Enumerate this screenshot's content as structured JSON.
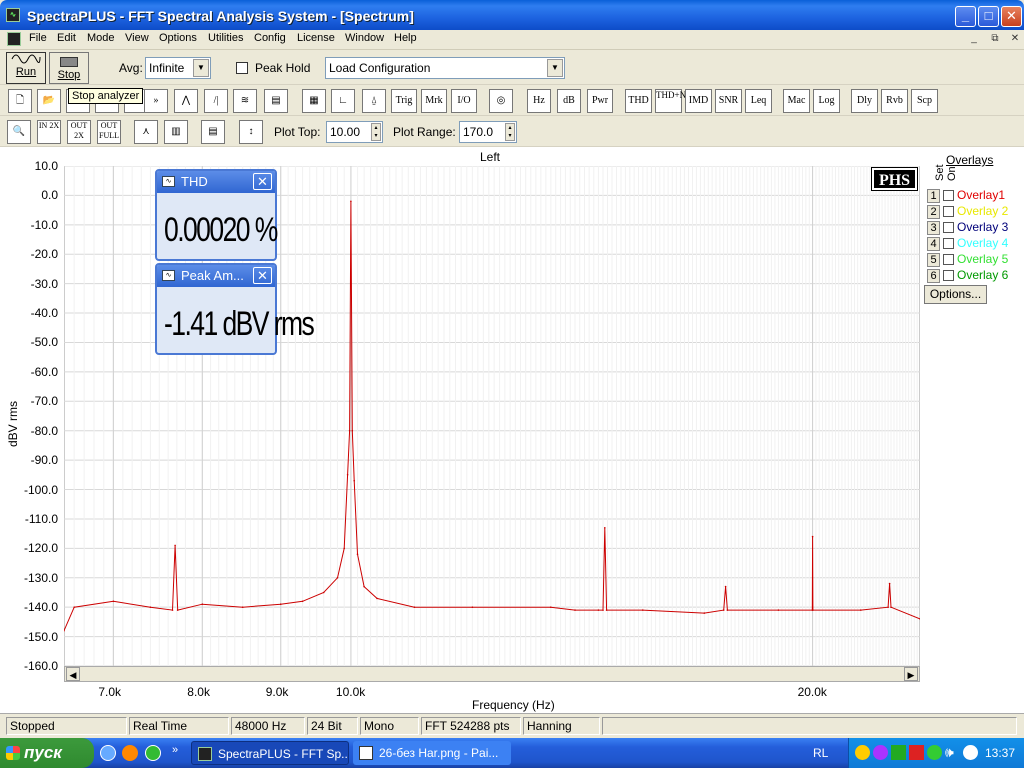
{
  "window": {
    "title": "SpectraPLUS - FFT Spectral Analysis System - [Spectrum]"
  },
  "menu": [
    "File",
    "Edit",
    "Mode",
    "View",
    "Options",
    "Utilities",
    "Config",
    "License",
    "Window",
    "Help"
  ],
  "toolbar1": {
    "run_label": "Run",
    "stop_label": "Stop",
    "avg_label": "Avg:",
    "avg_value": "Infinite",
    "peak_hold_label": "Peak Hold",
    "config_value": "Load Configuration"
  },
  "tooltip": "Stop analyzer",
  "toolbar2": {
    "buttons": [
      "Trig",
      "Mrk",
      "I/O",
      "Hz",
      "dB",
      "Pwr",
      "THD",
      "THD+N",
      "IMD",
      "SNR",
      "Leq",
      "Mac",
      "Log",
      "Dly",
      "Rvb",
      "Scp"
    ]
  },
  "toolbar3": {
    "zoom_labels": [
      "IN 2X",
      "OUT 2X",
      "OUT FULL"
    ],
    "plot_top_label": "Plot Top:",
    "plot_top_value": "10.00",
    "plot_range_label": "Plot Range:",
    "plot_range_value": "170.0"
  },
  "plot": {
    "channel": "Left",
    "logo": "PHS",
    "ylabel": "dBV rms",
    "xlabel": "Frequency (Hz)"
  },
  "chart_data": {
    "type": "line",
    "title": "Left",
    "xlabel": "Frequency (Hz)",
    "ylabel": "dBV rms",
    "x_scale": "log",
    "xlim": [
      6500,
      23500
    ],
    "ylim": [
      -160,
      10
    ],
    "y_ticks": [
      "10.0",
      "0.0",
      "-10.0",
      "-20.0",
      "-30.0",
      "-40.0",
      "-50.0",
      "-60.0",
      "-70.0",
      "-80.0",
      "-90.0",
      "-100.0",
      "-110.0",
      "-120.0",
      "-130.0",
      "-140.0",
      "-150.0",
      "-160.0"
    ],
    "x_ticks": [
      {
        "label": "7.0k",
        "value": 7000
      },
      {
        "label": "8.0k",
        "value": 8000
      },
      {
        "label": "9.0k",
        "value": 9000
      },
      {
        "label": "10.0k",
        "value": 10000
      },
      {
        "label": "20.0k",
        "value": 20000
      }
    ],
    "grid": true,
    "series": [
      {
        "color": "#cc0000",
        "points": [
          [
            6500,
            -148
          ],
          [
            6600,
            -140
          ],
          [
            7000,
            -138
          ],
          [
            7400,
            -140
          ],
          [
            7650,
            -141
          ],
          [
            7680,
            -119
          ],
          [
            7710,
            -141
          ],
          [
            8000,
            -139
          ],
          [
            8500,
            -140
          ],
          [
            9000,
            -139
          ],
          [
            9300,
            -138
          ],
          [
            9600,
            -135
          ],
          [
            9800,
            -130
          ],
          [
            9900,
            -120
          ],
          [
            9950,
            -95
          ],
          [
            9980,
            -80
          ],
          [
            10000,
            -2
          ],
          [
            10020,
            -80
          ],
          [
            10050,
            -97
          ],
          [
            10100,
            -122
          ],
          [
            10200,
            -133
          ],
          [
            10400,
            -137
          ],
          [
            11000,
            -140
          ],
          [
            12000,
            -140
          ],
          [
            13500,
            -140
          ],
          [
            14000,
            -141
          ],
          [
            14500,
            -141
          ],
          [
            14600,
            -141
          ],
          [
            14640,
            -113
          ],
          [
            14680,
            -141
          ],
          [
            15500,
            -141
          ],
          [
            17000,
            -142
          ],
          [
            17500,
            -141
          ],
          [
            17550,
            -133
          ],
          [
            17600,
            -141
          ],
          [
            19000,
            -141
          ],
          [
            19990,
            -141
          ],
          [
            20000,
            -116
          ],
          [
            20010,
            -141
          ],
          [
            21500,
            -141
          ],
          [
            22400,
            -140
          ],
          [
            22450,
            -132
          ],
          [
            22500,
            -140
          ],
          [
            23500,
            -144
          ]
        ]
      }
    ]
  },
  "thd_window": {
    "title": "THD",
    "value": "0.00020 %"
  },
  "peak_window": {
    "title": "Peak Am...",
    "value": "-1.41 dBV rms"
  },
  "overlays": {
    "title": "Overlays",
    "set_label": "Set",
    "on_label": "On",
    "items": [
      {
        "num": "1",
        "name": "Overlay1",
        "color": "#e00000"
      },
      {
        "num": "2",
        "name": "Overlay 2",
        "color": "#e8e800"
      },
      {
        "num": "3",
        "name": "Overlay 3",
        "color": "#00007a"
      },
      {
        "num": "4",
        "name": "Overlay 4",
        "color": "#33ffff"
      },
      {
        "num": "5",
        "name": "Overlay 5",
        "color": "#33e033"
      },
      {
        "num": "6",
        "name": "Overlay 6",
        "color": "#009900"
      }
    ],
    "options_label": "Options..."
  },
  "status": [
    "Stopped",
    "Real Time",
    "48000 Hz",
    "24 Bit",
    "Mono",
    "FFT 524288 pts",
    "Hanning"
  ],
  "taskbar": {
    "start_label": "пуск",
    "tasks": [
      "SpectraPLUS - FFT Sp...",
      "26-без Har.png - Pai..."
    ],
    "lang": "RL",
    "clock": "13:37"
  }
}
